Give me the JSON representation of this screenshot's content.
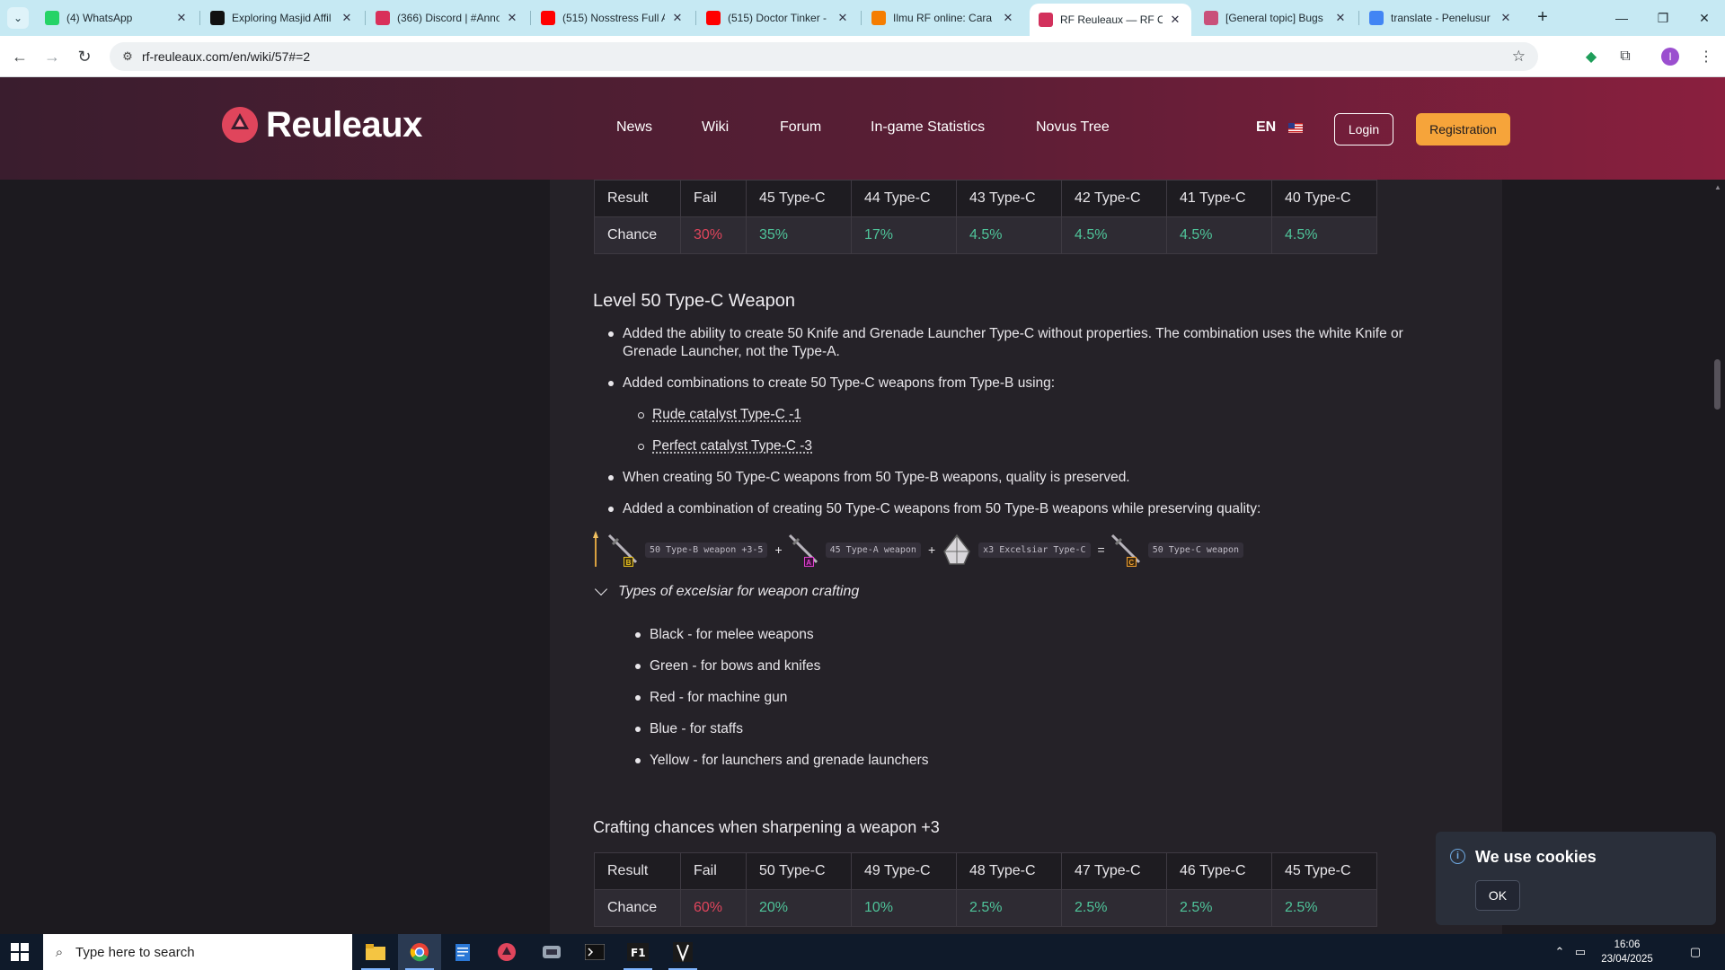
{
  "browser": {
    "tabs": [
      {
        "label": "(4) WhatsApp",
        "icon": "whatsapp-icon",
        "color": "#25d366"
      },
      {
        "label": "Exploring Masjid Affil",
        "icon": "tiktok-icon",
        "color": "#111111"
      },
      {
        "label": "(366) Discord | #Anno",
        "icon": "discord-icon",
        "color": "#d9305a"
      },
      {
        "label": "(515) Nosstress Full A",
        "icon": "youtube-icon",
        "color": "#ff0000"
      },
      {
        "label": "(515) Doctor Tinker -",
        "icon": "youtube-icon",
        "color": "#ff0000"
      },
      {
        "label": "Ilmu RF online: Cara",
        "icon": "blogger-icon",
        "color": "#f57d00"
      },
      {
        "label": "RF Reuleaux — RF O",
        "icon": "reuleaux-icon",
        "color": "#d2315c"
      },
      {
        "label": "[General topic] Bugs",
        "icon": "reuleaux-icon",
        "color": "#c9507a"
      },
      {
        "label": "translate - Penelusur",
        "icon": "google-icon",
        "color": "#4285f4"
      }
    ],
    "url": "rf-reuleaux.com/en/wiki/57#=2"
  },
  "site": {
    "logo_text": "Reuleaux",
    "nav": [
      "News",
      "Wiki",
      "Forum",
      "In-game Statistics",
      "Novus Tree"
    ],
    "lang": "EN",
    "login": "Login",
    "register": "Registration",
    "accent": "#f6a43a"
  },
  "table1": {
    "headers": [
      "Result",
      "Fail",
      "45 Type-C",
      "44 Type-C",
      "43 Type-C",
      "42 Type-C",
      "41 Type-C",
      "40 Type-C"
    ],
    "chance_label": "Chance",
    "values": [
      "30%",
      "35%",
      "17%",
      "4.5%",
      "4.5%",
      "4.5%",
      "4.5%"
    ]
  },
  "section": {
    "title": "Level 50 Type-C Weapon",
    "bullet1": "Added the ability to create 50 Knife and Grenade Launcher Type-C without properties. The combination uses the white Knife or",
    "bullet1b": "Grenade Launcher, not the Type-A.",
    "bullet2": "Added combinations to create 50 Type-C weapons from Type-B using:",
    "sub1": "Rude catalyst Type-C -1",
    "sub2": "Perfect catalyst Type-C -3",
    "bullet3": "When creating 50 Type-C weapons from 50 Type-B weapons, quality is preserved.",
    "bullet4": "Added a combination of creating 50 Type-C weapons from 50 Type-B weapons while preserving quality:"
  },
  "formula": {
    "chip1": "50 Type-B weapon +3-5",
    "chip2": "45 Type-A weapon",
    "chip3": "x3 Excelsiar Type-C",
    "chip4": "50 Type-C weapon",
    "plus": "+",
    "equals": "=",
    "grade_b": "B",
    "grade_a": "A",
    "grade_c": "C"
  },
  "excelsiar": {
    "summary": "Types of excelsiar for weapon crafting",
    "items": [
      "Black - for melee weapons",
      "Green - for bows and knifes",
      "Red - for machine gun",
      "Blue - for staffs",
      "Yellow - for launchers and grenade launchers"
    ]
  },
  "sharpen": {
    "title": "Crafting chances when sharpening a weapon +3",
    "headers": [
      "Result",
      "Fail",
      "50 Type-C",
      "49 Type-C",
      "48 Type-C",
      "47 Type-C",
      "46 Type-C",
      "45 Type-C"
    ],
    "chance_label": "Chance",
    "values": [
      "60%",
      "20%",
      "10%",
      "2.5%",
      "2.5%",
      "2.5%",
      "2.5%"
    ]
  },
  "cookie": {
    "title": "We use cookies",
    "ok": "OK"
  },
  "taskbar": {
    "search_placeholder": "Type here to search",
    "time": "16:06",
    "date": "23/04/2025"
  }
}
